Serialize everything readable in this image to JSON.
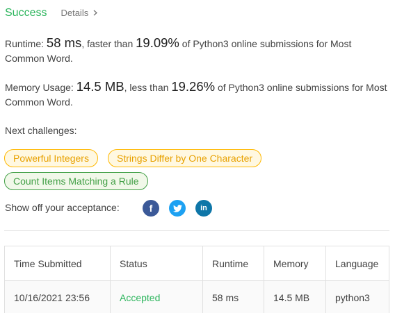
{
  "header": {
    "status": "Success",
    "details_label": "Details"
  },
  "runtime": {
    "label": "Runtime: ",
    "value": "58 ms",
    "comparison": ", faster than ",
    "percent": "19.09%",
    "suffix": " of Python3 online submissions for Most Common Word."
  },
  "memory": {
    "label": "Memory Usage: ",
    "value": "14.5 MB",
    "comparison": ", less than ",
    "percent": "19.26%",
    "suffix": " of Python3 online submissions for Most Common Word."
  },
  "challenges": {
    "label": "Next challenges:",
    "items": [
      {
        "title": "Powerful Integers",
        "difficulty": "medium"
      },
      {
        "title": "Strings Differ by One Character",
        "difficulty": "medium"
      },
      {
        "title": "Count Items Matching a Rule",
        "difficulty": "easy"
      }
    ]
  },
  "share": {
    "label": "Show off your acceptance:",
    "icons": [
      "facebook-icon",
      "twitter-icon",
      "linkedin-icon"
    ]
  },
  "table": {
    "headers": [
      "Time Submitted",
      "Status",
      "Runtime",
      "Memory",
      "Language"
    ],
    "rows": [
      [
        "10/16/2021 23:56",
        "Accepted",
        "58 ms",
        "14.5 MB",
        "python3"
      ]
    ]
  },
  "colors": {
    "success": "#2db55d",
    "medium_tag": "#ffb800",
    "easy_tag": "#43a047",
    "facebook": "#3b5998",
    "twitter": "#1da1f2",
    "linkedin": "#0e76a8"
  }
}
